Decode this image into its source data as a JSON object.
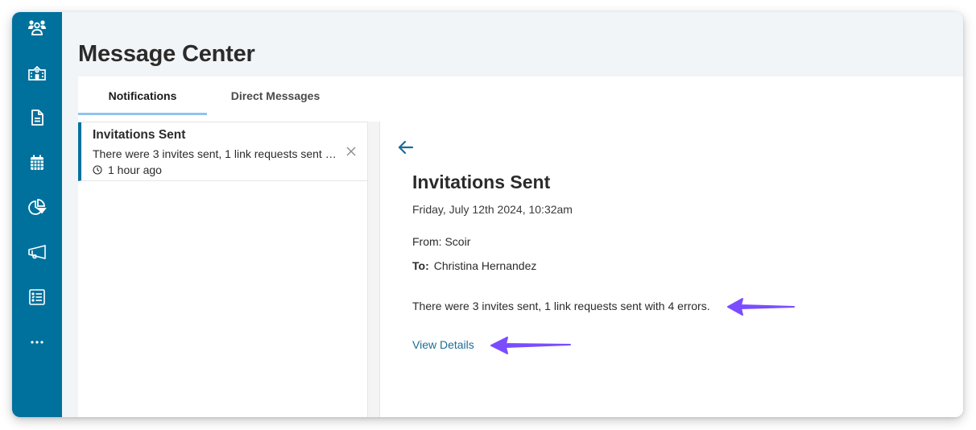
{
  "sidebar": {
    "items": [
      {
        "name": "people",
        "icon": "users-icon"
      },
      {
        "name": "schools",
        "icon": "school-building-icon"
      },
      {
        "name": "documents",
        "icon": "document-icon"
      },
      {
        "name": "calendar",
        "icon": "calendar-icon"
      },
      {
        "name": "reports",
        "icon": "pie-chart-icon"
      },
      {
        "name": "announcements",
        "icon": "megaphone-icon"
      },
      {
        "name": "checklists",
        "icon": "checklist-icon"
      },
      {
        "name": "more",
        "icon": "more-horizontal-icon"
      }
    ],
    "background_color": "#00719c"
  },
  "header": {
    "title": "Message Center"
  },
  "tabs": [
    {
      "label": "Notifications",
      "active": true
    },
    {
      "label": "Direct Messages",
      "active": false
    }
  ],
  "notifications": [
    {
      "title": "Invitations Sent",
      "preview": "There were 3 invites sent, 1 link requests sent with 4 errors.",
      "time": "1 hour ago",
      "selected": true
    }
  ],
  "detail": {
    "title": "Invitations Sent",
    "date": "Friday, July 12th 2024, 10:32am",
    "from_label": "From:",
    "from_value": "Scoir",
    "to_label": "To:",
    "to_value": "Christina Hernandez",
    "body": "There were 3 invites sent, 1 link requests sent with 4 errors.",
    "link_label": "View Details"
  },
  "colors": {
    "accent": "#00719c",
    "link": "#1b6d96",
    "tab_underline": "#90c4ef",
    "annotation_arrow": "#7b4dff"
  }
}
